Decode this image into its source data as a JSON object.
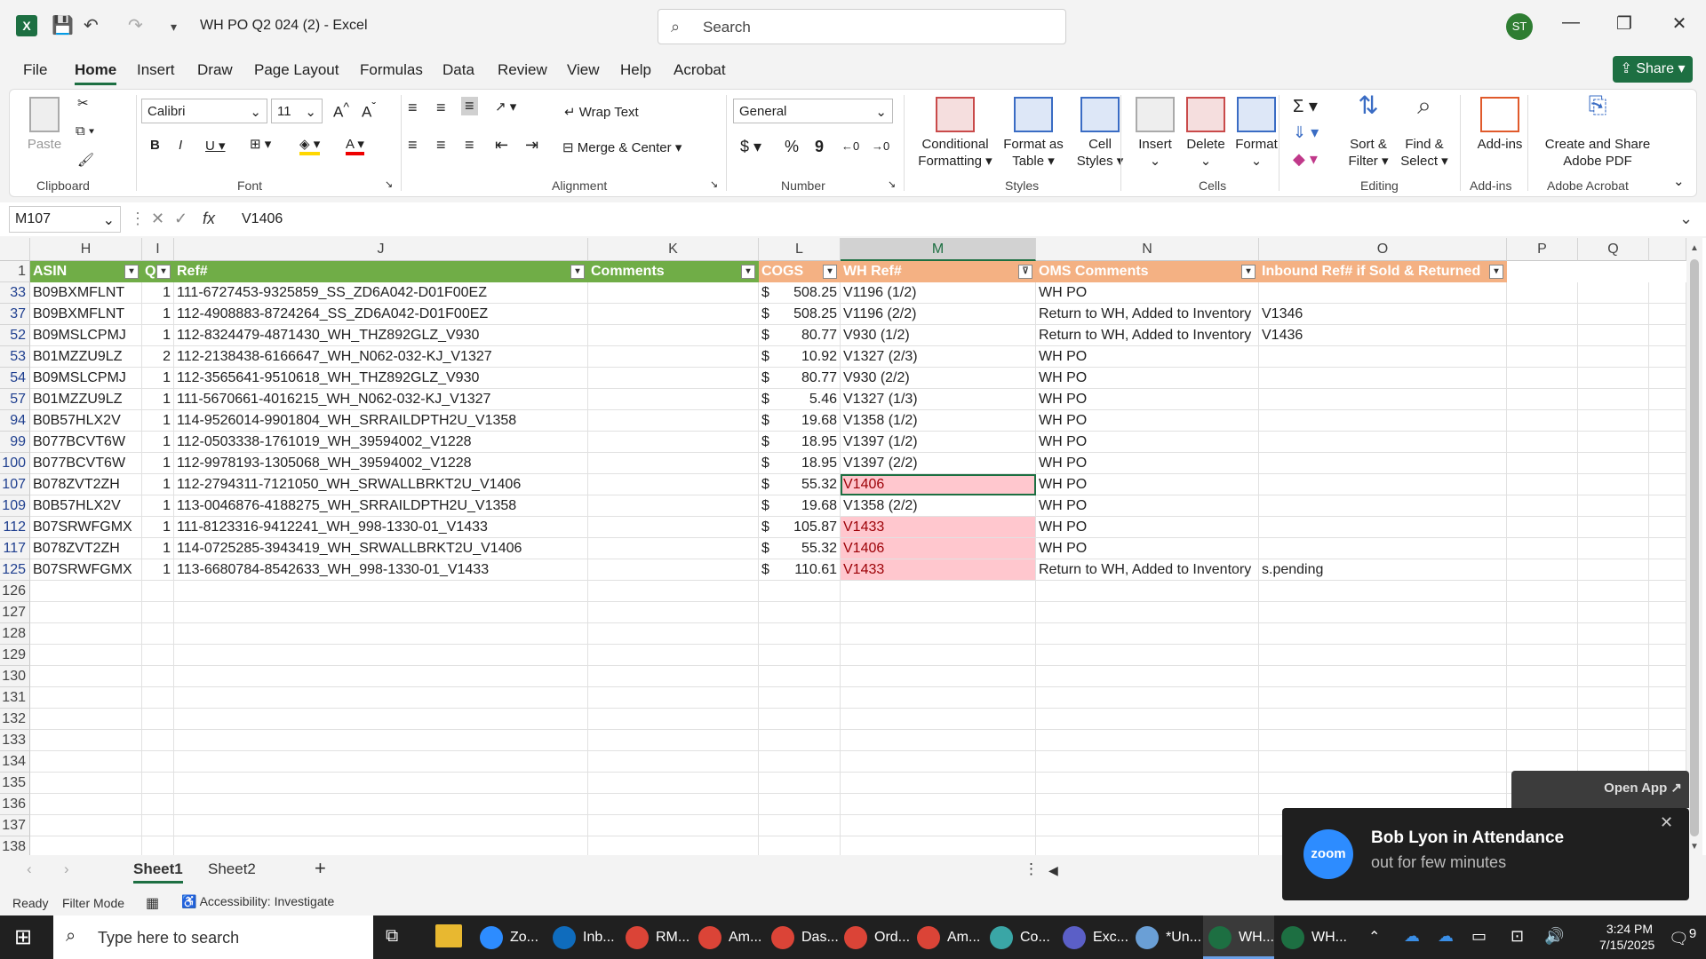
{
  "window": {
    "title": "WH PO Q2 024 (2)  -  Excel",
    "search_placeholder": "Search",
    "user_initials": "ST",
    "minimize": "—",
    "maximize": "❐",
    "close": "✕"
  },
  "menu": {
    "items": [
      "File",
      "Home",
      "Insert",
      "Draw",
      "Page Layout",
      "Formulas",
      "Data",
      "Review",
      "View",
      "Help",
      "Acrobat"
    ],
    "share": "Share"
  },
  "ribbon": {
    "clipboard": {
      "paste": "Paste",
      "label": "Clipboard"
    },
    "font": {
      "name": "Calibri",
      "size": "11",
      "label": "Font"
    },
    "alignment": {
      "wrap": "Wrap Text",
      "merge": "Merge & Center",
      "label": "Alignment"
    },
    "number": {
      "format": "General",
      "currency": "$",
      "percent": "%",
      "comma": "9",
      "label": "Number"
    },
    "styles": {
      "conditional": "Conditional",
      "conditional2": "Formatting",
      "format_table": "Format as",
      "format_table2": "Table",
      "cell_styles": "Cell",
      "cell_styles2": "Styles",
      "label": "Styles"
    },
    "cells": {
      "insert": "Insert",
      "delete": "Delete",
      "format": "Format",
      "label": "Cells"
    },
    "editing": {
      "sigma": "Σ",
      "sort": "Sort &",
      "sort2": "Filter",
      "find": "Find &",
      "find2": "Select",
      "label": "Editing"
    },
    "addins": {
      "name": "Add-ins",
      "label": "Add-ins"
    },
    "acrobat": {
      "name": "Create and Share",
      "name2": "Adobe PDF",
      "label": "Adobe Acrobat"
    }
  },
  "formula_bar": {
    "name_box": "M107",
    "value": "V1406",
    "fx": "fx"
  },
  "columns": [
    "H",
    "I",
    "J",
    "K",
    "L",
    "M",
    "N",
    "O",
    "P",
    "Q"
  ],
  "header_row": {
    "row": "1",
    "ASIN": "ASIN",
    "Q": "Q",
    "Ref": "Ref#",
    "Comments": "Comments",
    "COGS": "COGS",
    "WHRef": "WH Ref#",
    "OMS": "OMS Comments",
    "Inbound": "Inbound Ref# if Sold & Returned"
  },
  "rows": [
    {
      "row": "33",
      "asin": "B09BXMFLNT",
      "q": "1",
      "ref": "111-6727453-9325859_SS_ZD6A042-D01F00EZ",
      "cur": "$",
      "cogs": "508.25",
      "wh": "V1196  (1/2)",
      "oms": "WH PO",
      "inb": "",
      "pink": false
    },
    {
      "row": "37",
      "asin": "B09BXMFLNT",
      "q": "1",
      "ref": "112-4908883-8724264_SS_ZD6A042-D01F00EZ",
      "cur": "$",
      "cogs": "508.25",
      "wh": "V1196 (2/2)",
      "oms": "Return to WH, Added to Inventory",
      "inb": "V1346",
      "pink": false
    },
    {
      "row": "52",
      "asin": "B09MSLCPMJ",
      "q": "1",
      "ref": "112-8324479-4871430_WH_THZ892GLZ_V930",
      "cur": "$",
      "cogs": "80.77",
      "wh": "V930 (1/2)",
      "oms": "Return to WH, Added to Inventory",
      "inb": "V1436",
      "pink": false
    },
    {
      "row": "53",
      "asin": "B01MZZU9LZ",
      "q": "2",
      "ref": "112-2138438-6166647_WH_N062-032-KJ_V1327",
      "cur": "$",
      "cogs": "10.92",
      "wh": "V1327 (2/3)",
      "oms": "WH PO",
      "inb": "",
      "pink": false
    },
    {
      "row": "54",
      "asin": "B09MSLCPMJ",
      "q": "1",
      "ref": "112-3565641-9510618_WH_THZ892GLZ_V930",
      "cur": "$",
      "cogs": "80.77",
      "wh": "V930 (2/2)",
      "oms": "WH PO",
      "inb": "",
      "pink": false
    },
    {
      "row": "57",
      "asin": "B01MZZU9LZ",
      "q": "1",
      "ref": "111-5670661-4016215_WH_N062-032-KJ_V1327",
      "cur": "$",
      "cogs": "5.46",
      "wh": "V1327 (1/3)",
      "oms": "WH PO",
      "inb": "",
      "pink": false
    },
    {
      "row": "94",
      "asin": "B0B57HLX2V",
      "q": "1",
      "ref": "114-9526014-9901804_WH_SRRAILDPTH2U_V1358",
      "cur": "$",
      "cogs": "19.68",
      "wh": "V1358 (1/2)",
      "oms": "WH PO",
      "inb": "",
      "pink": false
    },
    {
      "row": "99",
      "asin": "B077BCVT6W",
      "q": "1",
      "ref": "112-0503338-1761019_WH_39594002_V1228",
      "cur": "$",
      "cogs": "18.95",
      "wh": "V1397 (1/2)",
      "oms": "WH PO",
      "inb": "",
      "pink": false
    },
    {
      "row": "100",
      "asin": "B077BCVT6W",
      "q": "1",
      "ref": "112-9978193-1305068_WH_39594002_V1228",
      "cur": "$",
      "cogs": "18.95",
      "wh": "V1397 (2/2)",
      "oms": "WH PO",
      "inb": "",
      "pink": false
    },
    {
      "row": "107",
      "asin": "B078ZVT2ZH",
      "q": "1",
      "ref": "112-2794311-7121050_WH_SRWALLBRKT2U_V1406",
      "cur": "$",
      "cogs": "55.32",
      "wh": "V1406",
      "oms": "WH PO",
      "inb": "",
      "pink": true
    },
    {
      "row": "109",
      "asin": "B0B57HLX2V",
      "q": "1",
      "ref": "113-0046876-4188275_WH_SRRAILDPTH2U_V1358",
      "cur": "$",
      "cogs": "19.68",
      "wh": "V1358 (2/2)",
      "oms": "WH PO",
      "inb": "",
      "pink": false
    },
    {
      "row": "112",
      "asin": "B07SRWFGMX",
      "q": "1",
      "ref": "111-8123316-9412241_WH_998-1330-01_V1433",
      "cur": "$",
      "cogs": "105.87",
      "wh": "V1433",
      "oms": "WH PO",
      "inb": "",
      "pink": true
    },
    {
      "row": "117",
      "asin": "B078ZVT2ZH",
      "q": "1",
      "ref": "114-0725285-3943419_WH_SRWALLBRKT2U_V1406",
      "cur": "$",
      "cogs": "55.32",
      "wh": "V1406",
      "oms": "WH PO",
      "inb": "",
      "pink": true
    },
    {
      "row": "125",
      "asin": "B07SRWFGMX",
      "q": "1",
      "ref": "113-6680784-8542633_WH_998-1330-01_V1433",
      "cur": "$",
      "cogs": "110.61",
      "wh": "V1433",
      "oms": "Return to WH, Added to Inventory",
      "inb": "s.pending",
      "pink": true
    }
  ],
  "empty_rows": [
    "126",
    "127",
    "128",
    "129",
    "130",
    "131",
    "132",
    "133",
    "134",
    "135",
    "136",
    "137",
    "138"
  ],
  "sheets": {
    "tabs": [
      "Sheet1",
      "Sheet2"
    ],
    "add": "+"
  },
  "status": {
    "ready": "Ready",
    "filter": "Filter Mode",
    "accessibility": "Accessibility: Investigate"
  },
  "taskbar": {
    "search": "Type here to search",
    "apps": [
      "Zo...",
      "Inb...",
      "RM...",
      "Am...",
      "Das...",
      "Ord...",
      "Am...",
      "Co...",
      "Exc...",
      "*Un...",
      "WH...",
      "WH..."
    ],
    "time": "3:24 PM",
    "date": "7/15/2025",
    "notif": "9"
  },
  "zoom": {
    "open_app": "Open App ↗",
    "logo": "zoom",
    "title": "Bob Lyon in Attendance",
    "subtitle": "out for few minutes"
  },
  "colors": {
    "excel_green": "#1d6f42",
    "header_green": "#70ad47",
    "header_orange": "#f4b183",
    "pink_fill": "#ffc7ce",
    "pink_text": "#9c0006"
  }
}
